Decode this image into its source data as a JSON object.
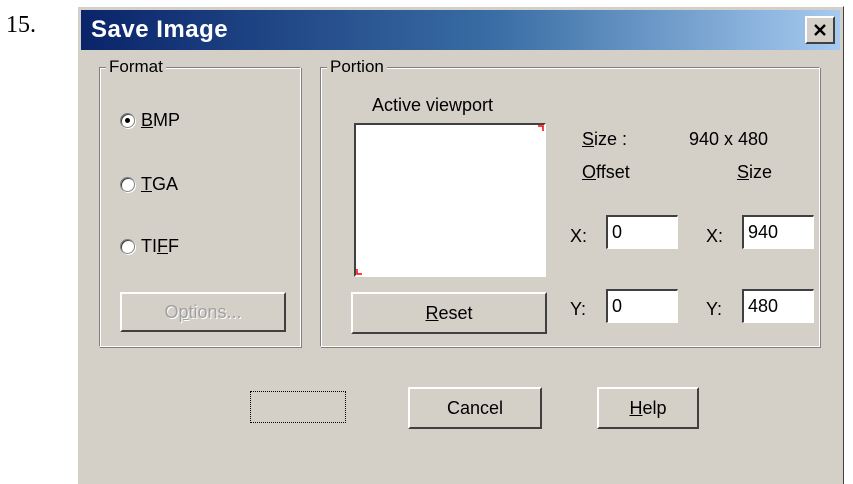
{
  "step_number": "15.",
  "dialog": {
    "title": "Save Image",
    "close_symbol": "×"
  },
  "format": {
    "label": "Format",
    "options": [
      {
        "before": "",
        "mnemonic": "B",
        "after": "MP",
        "selected": true
      },
      {
        "before": "",
        "mnemonic": "T",
        "after": "GA",
        "selected": false
      },
      {
        "before": "TI",
        "mnemonic": "F",
        "after": "F",
        "selected": false
      }
    ],
    "options_button": {
      "before": "O",
      "mnemonic": "p",
      "after": "tions...",
      "disabled": true
    }
  },
  "portion": {
    "label": "Portion",
    "viewport_label": "Active viewport",
    "reset_button": {
      "mnemonic": "R",
      "after": "eset"
    },
    "size_label": {
      "mnemonic": "S",
      "after": "ize :"
    },
    "size_value": "940 x 480",
    "offset_header": {
      "mnemonic": "O",
      "after": "ffset"
    },
    "size_header": {
      "mnemonic": "S",
      "after": "ize"
    },
    "offset_x": {
      "label": "X:",
      "value": "0"
    },
    "offset_y": {
      "label": "Y:",
      "value": "0"
    },
    "size_x": {
      "label": "X:",
      "value": "940"
    },
    "size_y": {
      "label": "Y:",
      "value": "480"
    }
  },
  "buttons": {
    "ok_label": "",
    "cancel_label": "Cancel",
    "help": {
      "mnemonic": "H",
      "after": "elp"
    }
  },
  "colors": {
    "dialog_bg": "#d4d0c8",
    "title_start": "#0a246a",
    "title_end": "#a6caf0",
    "corner_marker": "#ff0000"
  },
  "icons": {
    "close": "close-icon",
    "radio_checked": "radio-checked-icon",
    "radio_unchecked": "radio-unchecked-icon"
  }
}
